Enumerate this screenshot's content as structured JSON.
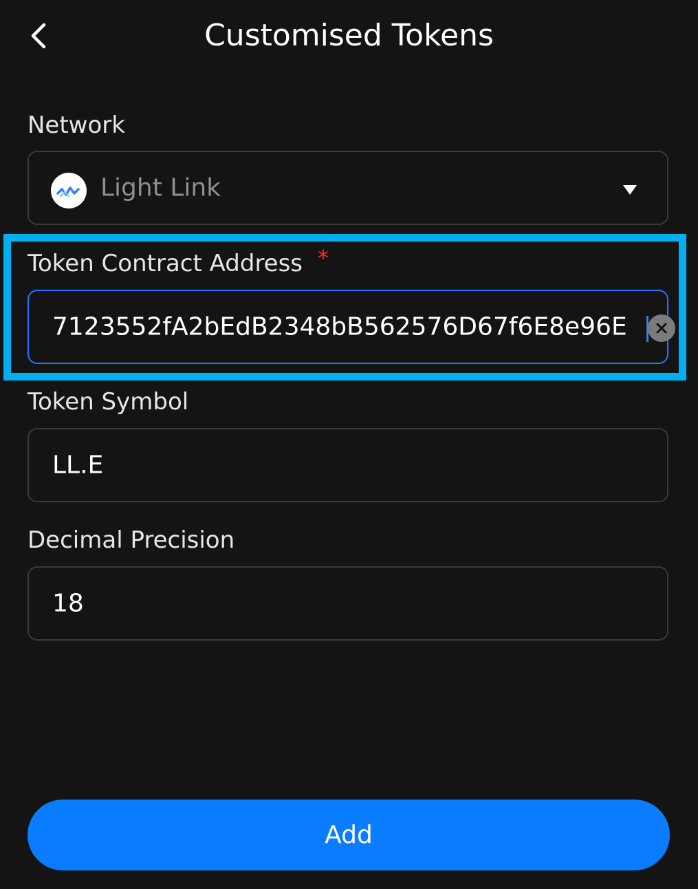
{
  "header": {
    "title": "Customised Tokens",
    "back_icon": "chevron-left-icon"
  },
  "form": {
    "network": {
      "label": "Network",
      "selected": "Light Link",
      "logo_icon": "light-link-logo-icon",
      "dropdown_icon": "caret-down-icon"
    },
    "contract_address": {
      "label": "Token Contract Address",
      "required_marker": "*",
      "value": "7123552fA2bEdB2348bB562576D67f6E8e96E",
      "clear_icon": "clear-x-icon"
    },
    "symbol": {
      "label": "Token Symbol",
      "value": "LL.E"
    },
    "decimals": {
      "label": "Decimal Precision",
      "value": "18"
    }
  },
  "actions": {
    "add_label": "Add"
  },
  "colors": {
    "background": "#141414",
    "accent": "#0a7cff",
    "highlight": "#00b0f0",
    "required": "#ff2a2a"
  }
}
